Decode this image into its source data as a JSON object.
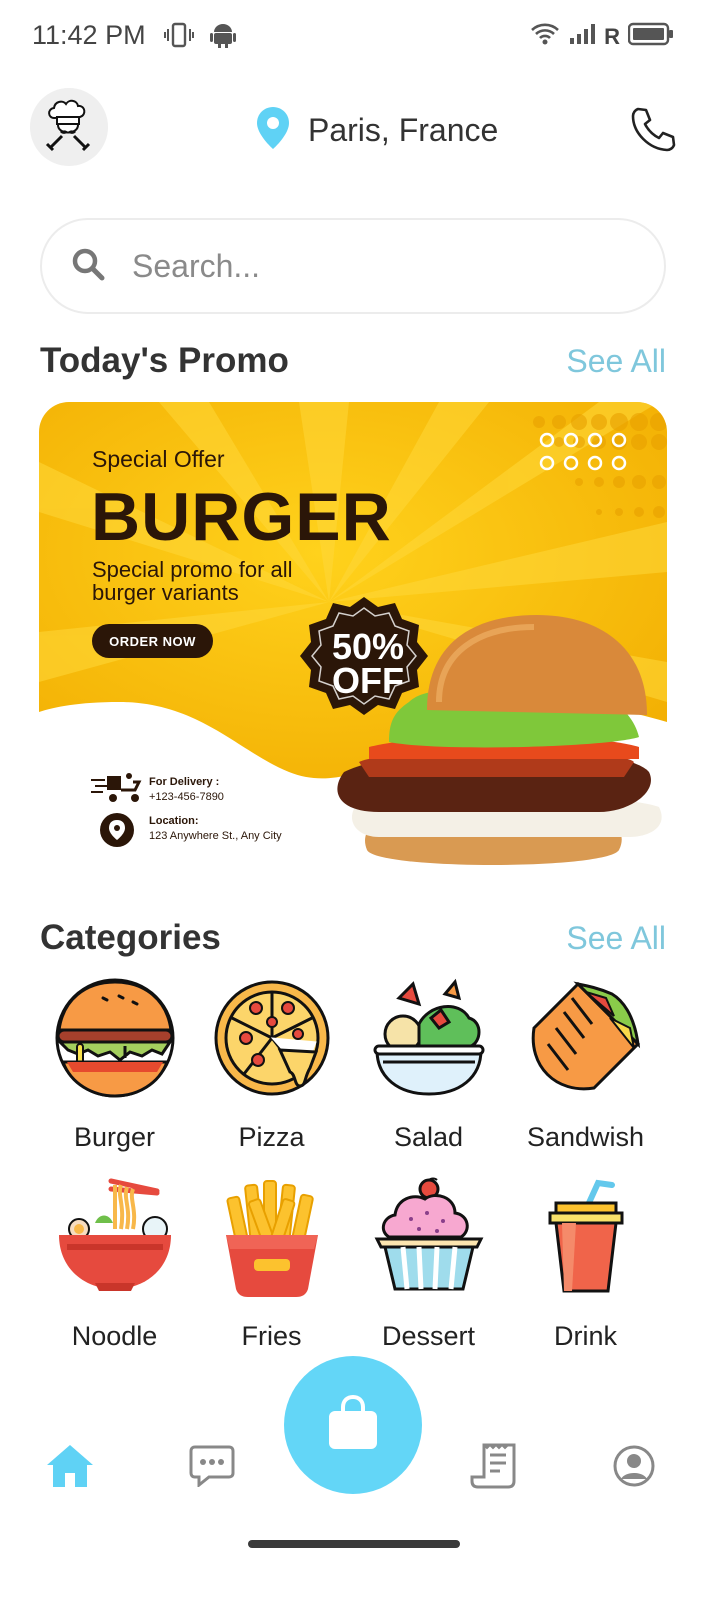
{
  "status_bar": {
    "time": "11:42 PM",
    "carrier": "R",
    "icons": [
      "vibrate-icon",
      "android-icon",
      "wifi-icon",
      "signal-icon",
      "battery-icon"
    ]
  },
  "header": {
    "logo": "chef-logo",
    "location": "Paris, France",
    "location_icon": "location-pin-icon",
    "phone_icon": "phone-icon"
  },
  "search": {
    "placeholder": "Search...",
    "icon": "search-icon"
  },
  "promo_section": {
    "title": "Today's Promo",
    "see_all": "See All",
    "banner": {
      "kicker": "Special Offer",
      "headline": "BURGER",
      "description": "Special promo for all burger variants",
      "button": "ORDER NOW",
      "badge_line1": "50%",
      "badge_line2": "OFF",
      "delivery_label": "For Delivery :",
      "delivery_phone": "+123-456-7890",
      "location_label": "Location:",
      "location_address": "123 Anywhere St., Any City"
    }
  },
  "categories_section": {
    "title": "Categories",
    "see_all": "See All",
    "items": [
      {
        "label": "Burger",
        "icon": "burger-icon"
      },
      {
        "label": "Pizza",
        "icon": "pizza-icon"
      },
      {
        "label": "Salad",
        "icon": "salad-icon"
      },
      {
        "label": "Sandwish",
        "icon": "sandwich-icon"
      },
      {
        "label": "Noodle",
        "icon": "noodle-icon"
      },
      {
        "label": "Fries",
        "icon": "fries-icon"
      },
      {
        "label": "Dessert",
        "icon": "cupcake-icon"
      },
      {
        "label": "Drink",
        "icon": "drink-icon"
      }
    ]
  },
  "bottom_nav": {
    "items": [
      "home-icon",
      "chat-icon",
      "shopping-bag-icon",
      "receipt-icon",
      "profile-icon"
    ],
    "active": "home-icon"
  },
  "colors": {
    "accent": "#63d6f7",
    "see_all": "#7fc7dc",
    "promo_yellow": "#f5b400",
    "promo_dark": "#2b1608"
  }
}
